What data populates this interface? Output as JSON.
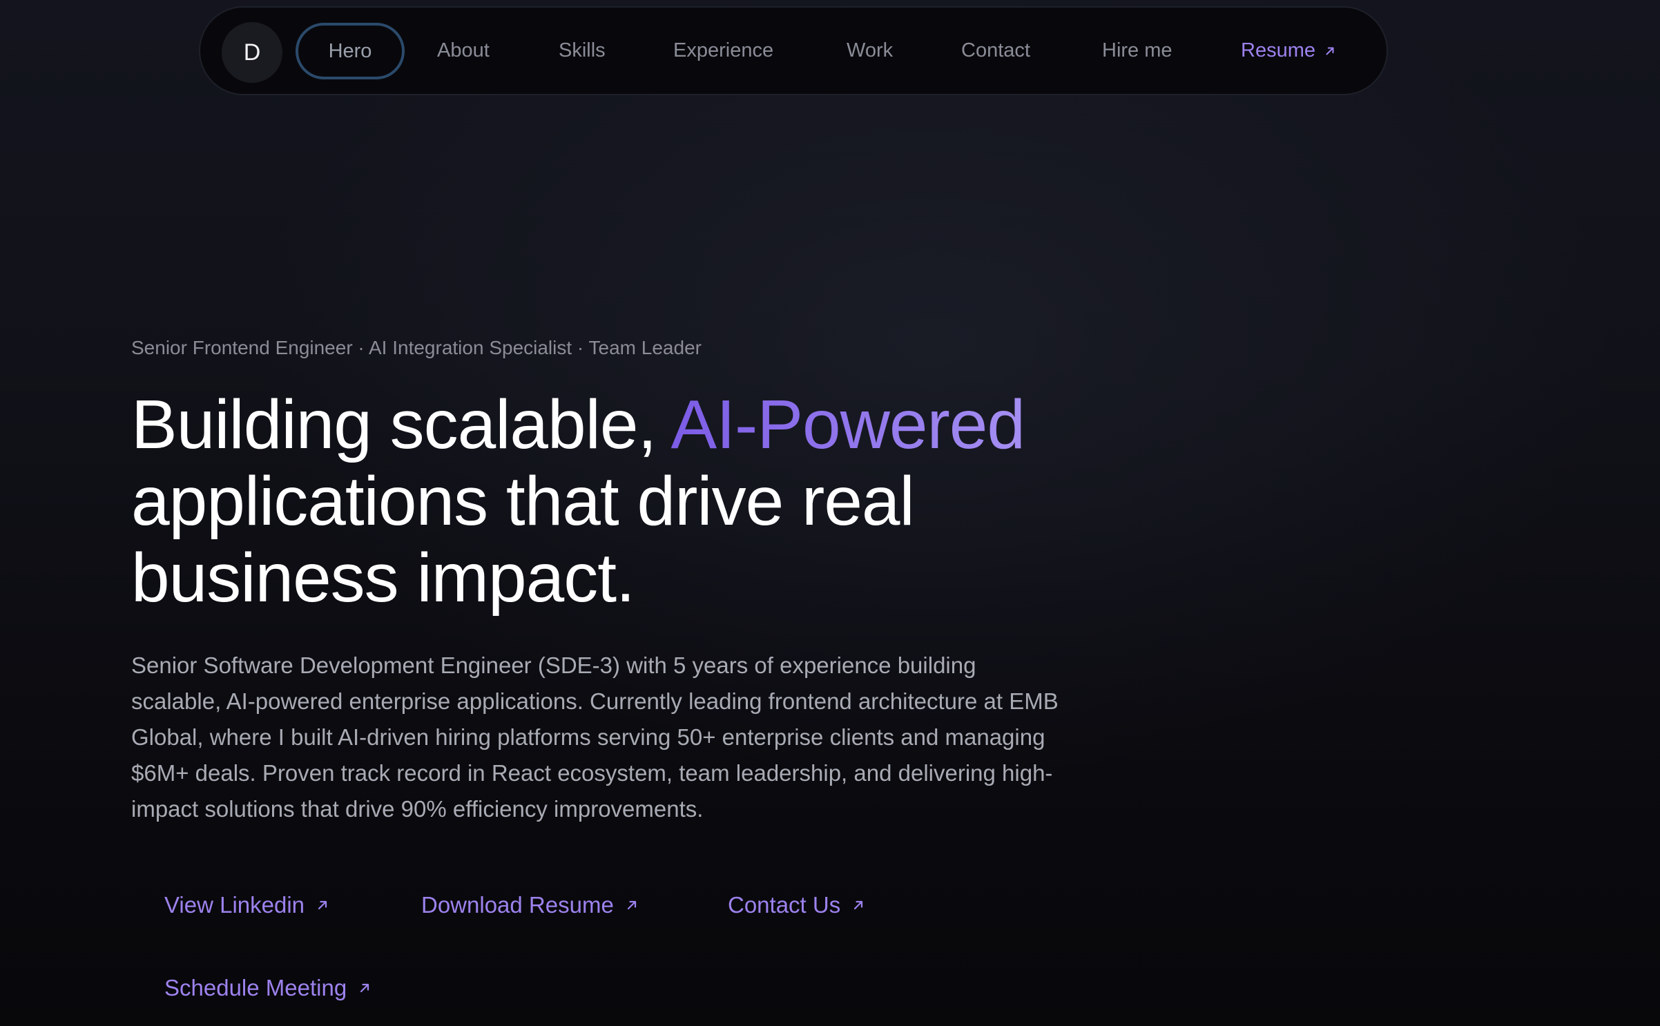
{
  "nav": {
    "logo": "D",
    "items": [
      {
        "label": "Hero",
        "active": true
      },
      {
        "label": "About"
      },
      {
        "label": "Skills"
      },
      {
        "label": "Experience"
      },
      {
        "label": "Work"
      },
      {
        "label": "Contact"
      },
      {
        "label": "Hire me"
      }
    ],
    "resume_label": "Resume"
  },
  "hero": {
    "kicker": "Senior Frontend Engineer · AI Integration Specialist · Team Leader",
    "headline_part1": "Building scalable, ",
    "headline_accent": "AI-Powered",
    "headline_part2": "applications that drive real business impact.",
    "description": "Senior Software Development Engineer (SDE-3) with 5 years of experience building scalable, AI-powered enterprise applications. Currently leading frontend architecture at EMB Global, where I built AI-driven hiring platforms serving 50+ enterprise clients and managing $6M+ deals. Proven track record in React ecosystem, team leadership, and delivering high-impact solutions that drive 90% efficiency improvements."
  },
  "cta": {
    "linkedin": "View Linkedin",
    "download_resume": "Download Resume",
    "contact": "Contact Us",
    "schedule": "Schedule Meeting"
  },
  "colors": {
    "accent": "#9d82ee",
    "accent_gradient_start": "#7c5ce6",
    "accent_gradient_end": "#a58ff2",
    "active_nav_border": "#2b4a6b",
    "background": "#0a0b10"
  },
  "icons": {
    "external_link": "arrow-up-right-icon"
  }
}
